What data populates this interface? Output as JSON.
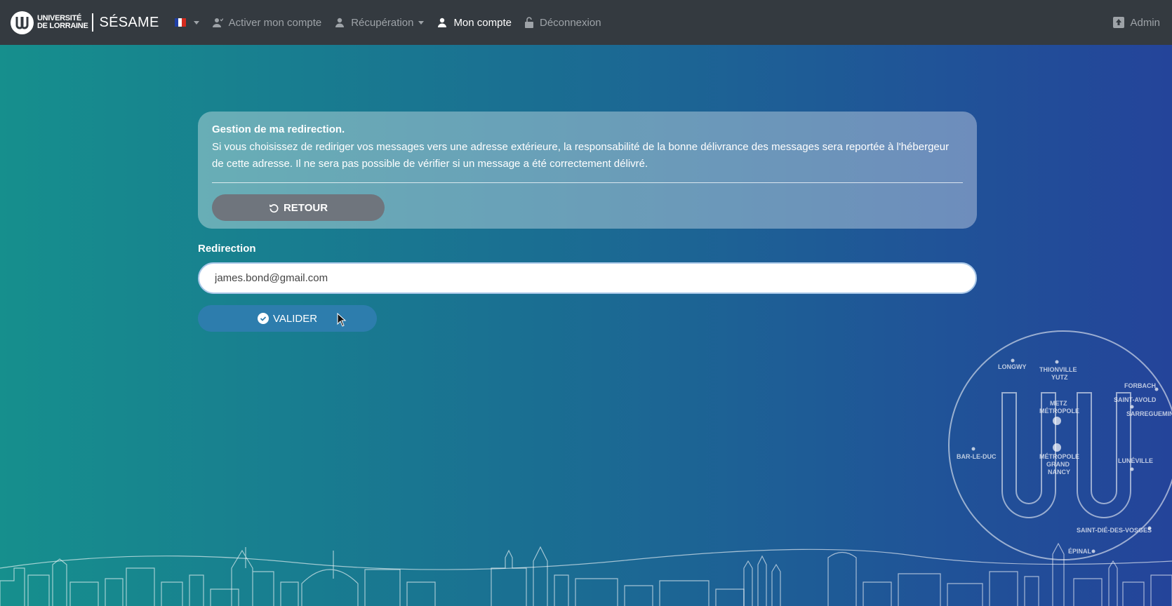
{
  "brand": {
    "university_line1": "UNIVERSITÉ",
    "university_line2": "DE LORRAINE",
    "app_name": "SÉSAME"
  },
  "nav": {
    "language": "fr",
    "activate": "Activer mon compte",
    "recovery": "Récupération",
    "account": "Mon compte",
    "logout": "Déconnexion",
    "admin": "Admin"
  },
  "card": {
    "title": "Gestion de ma redirection.",
    "text": "Si vous choisissez de rediriger vos messages vers une adresse extérieure, la responsabilité de la bonne délivrance des messages sera reportée à l'hébergeur de cette adresse. Il ne sera pas possible de vérifier si un message a été correctement délivré.",
    "back_button": "RETOUR"
  },
  "form": {
    "label": "Redirection",
    "value": "james.bond@gmail.com",
    "submit_button": "VALIDER"
  },
  "map": {
    "cities": [
      "LONGWY",
      "THIONVILLE",
      "YUTZ",
      "FORBACH",
      "SAINT-AVOLD",
      "SARREGUEMINES",
      "METZ",
      "MÉTROPOLE",
      "BAR-LE-DUC",
      "MÉTROPOLE",
      "GRAND",
      "NANCY",
      "LUNÉVILLE",
      "SAINT-DIÉ-DES-VOSGES",
      "ÉPINAL"
    ]
  },
  "colors": {
    "navbar": "#343a40",
    "nav_text": "#9ea3a8",
    "retour_button": "#6f757d",
    "valider_button": "#2d7dad"
  }
}
